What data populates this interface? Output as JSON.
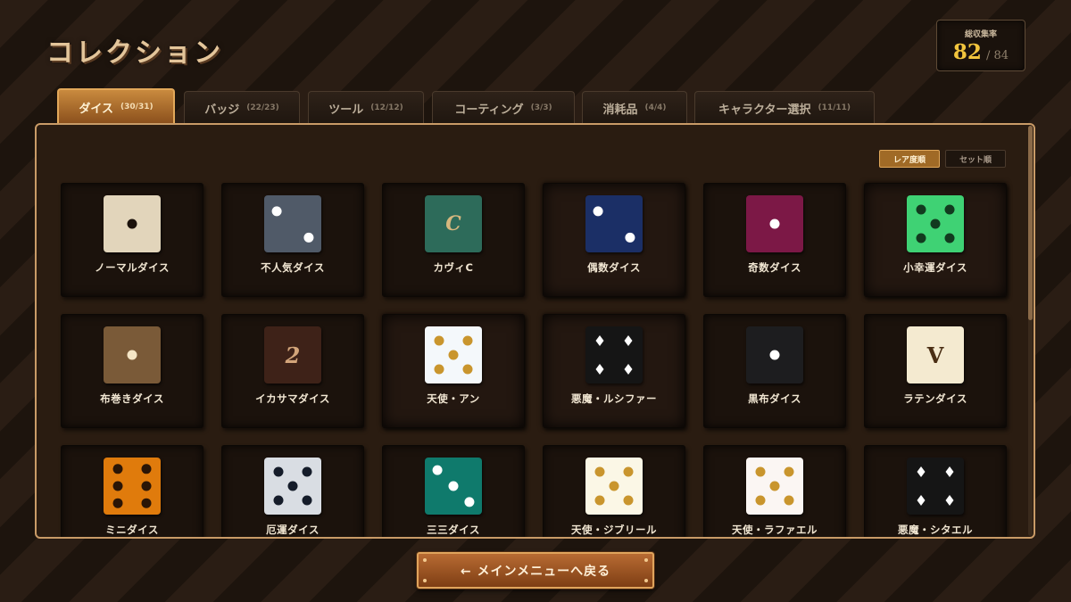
{
  "header": {
    "title": "コレクション"
  },
  "completion": {
    "label": "総収集率",
    "collected": "82",
    "total": "/ 84"
  },
  "tabs": [
    {
      "label": "ダイス",
      "count": "(30/31)",
      "active": true
    },
    {
      "label": "バッジ",
      "count": "(22/23)"
    },
    {
      "label": "ツール",
      "count": "(12/12)"
    },
    {
      "label": "コーティング",
      "count": "(3/3)"
    },
    {
      "label": "消耗品",
      "count": "(4/4)"
    },
    {
      "label": "キャラクター選択",
      "count": "(11/11)"
    }
  ],
  "sort": {
    "rarity_label": "レア度順",
    "set_label": "セット順",
    "selected": "rarity"
  },
  "dice": [
    {
      "name": "ノーマルダイス",
      "face": "#e2d5bb",
      "pip": "#1b120c",
      "pips": 1,
      "icon": "normal-die-icon"
    },
    {
      "name": "不人気ダイス",
      "face": "#505a68",
      "pip": "#ffffff",
      "pips": 2,
      "icon": "unpopular-die-icon"
    },
    {
      "name": "カヴィC",
      "face": "#2d6b5a",
      "letter": "C",
      "letter_color": "#d6b77e",
      "icon": "letter-c-die-icon"
    },
    {
      "name": "偶数ダイス",
      "face": "#1b2f66",
      "pip": "#ffffff",
      "pips": 2,
      "icon": "even-die-icon"
    },
    {
      "name": "奇数ダイス",
      "face": "#7c1846",
      "pip": "#ffffff",
      "pips": 1,
      "icon": "odd-die-icon"
    },
    {
      "name": "小幸運ダイス",
      "face": "#3fd274",
      "pip": "#123a1f",
      "pips": 5,
      "icon": "lucky-die-icon"
    },
    {
      "name": "布巻きダイス",
      "face": "#7a5a38",
      "pip": "#f5e6c6",
      "pips": 1,
      "icon": "cloth-die-icon"
    },
    {
      "name": "イカサマダイス",
      "face": "#3e2218",
      "letter": "2",
      "letter_color": "#d3a57a",
      "icon": "cheat-die-icon"
    },
    {
      "name": "天使・アン",
      "face": "#f4f8fb",
      "pip": "#c9952d",
      "pips": 5,
      "icon": "angel-die-icon"
    },
    {
      "name": "悪魔・ルシファー",
      "face": "#151515",
      "pip": "#ffffff",
      "pips": 4,
      "pip_shape": "diamond",
      "icon": "demon-die-icon"
    },
    {
      "name": "黒布ダイス",
      "face": "#1d1d1f",
      "pip": "#ffffff",
      "pips": 1,
      "icon": "black-cloth-die-icon"
    },
    {
      "name": "ラテンダイス",
      "face": "#f4ead0",
      "letter": "V",
      "letter_color": "#4a2e14",
      "icon": "latin-die-icon"
    },
    {
      "name": "ミニダイス",
      "face": "#e07b0c",
      "pip": "#2a1506",
      "pips": 6,
      "icon": "mini-die-icon"
    },
    {
      "name": "厄運ダイス",
      "face": "#d9dde3",
      "pip": "#151c2a",
      "pips": 5,
      "icon": "unlucky-die-icon"
    },
    {
      "name": "三三ダイス",
      "face": "#0f7a6c",
      "pip": "#ffffff",
      "pips": 3,
      "icon": "three-die-icon"
    },
    {
      "name": "天使・ジブリール",
      "face": "#fbf7e6",
      "pip": "#c9952d",
      "pips": 5,
      "icon": "angel-gabriel-die-icon"
    },
    {
      "name": "天使・ラファエル",
      "face": "#fbf6f3",
      "pip": "#c9952d",
      "pips": 5,
      "icon": "angel-raphael-die-icon"
    },
    {
      "name": "悪魔・シタエル",
      "face": "#151515",
      "pip": "#ffffff",
      "pips": 4,
      "pip_shape": "diamond",
      "icon": "demon-die-icon-2"
    }
  ],
  "back_button": {
    "label": "← メインメニューへ戻る"
  }
}
